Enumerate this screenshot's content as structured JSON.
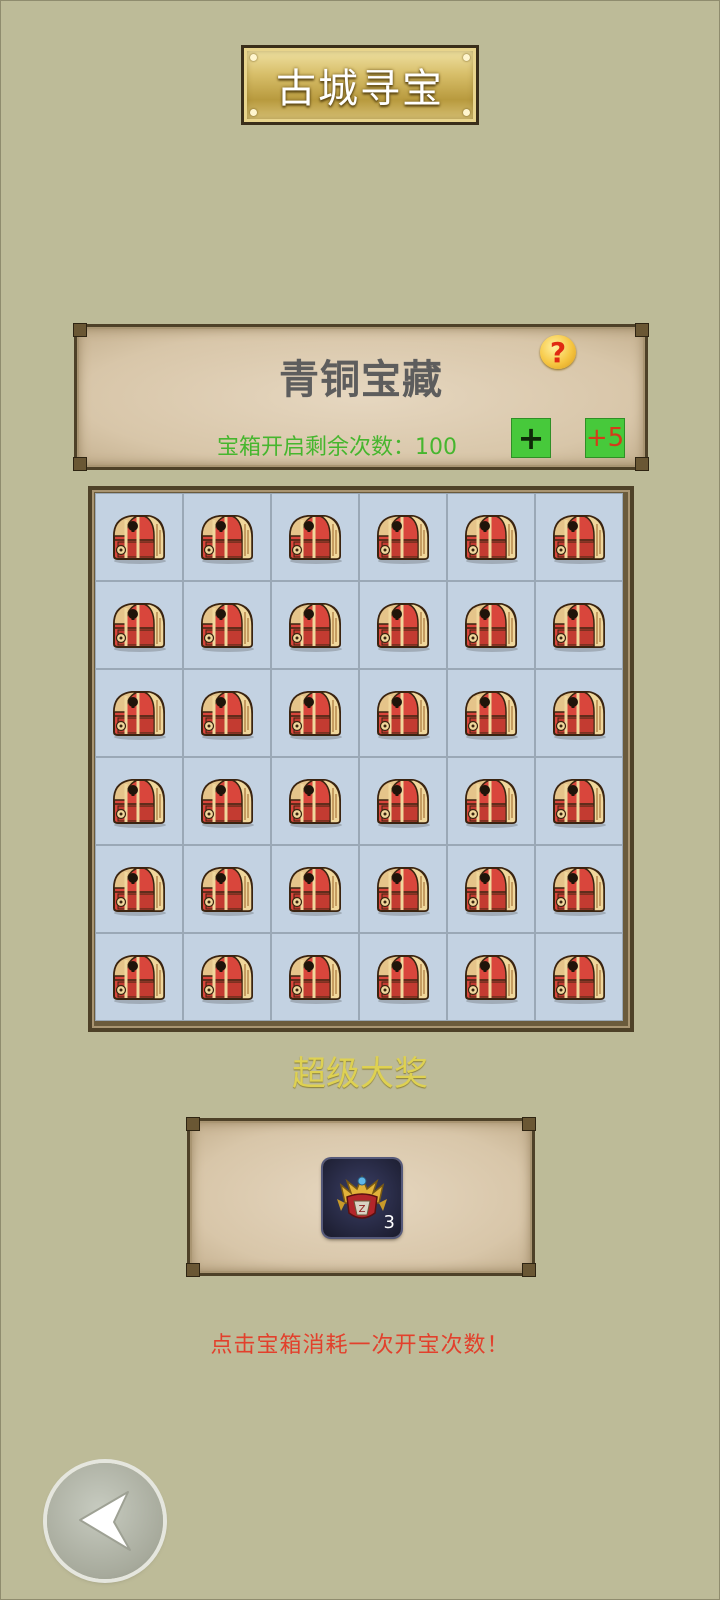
{
  "title": "古城寻宝",
  "info": {
    "treasure_name": "青铜宝藏",
    "help_icon": "question-mark-icon",
    "remaining_label": "宝箱开启剩余次数：",
    "remaining_count": "100",
    "add_one_label": "+",
    "add_five_label": "+5"
  },
  "grid": {
    "rows": 6,
    "cols": 6,
    "cell_icon": "treasure-chest-icon"
  },
  "super_prize": {
    "label": "超级大奖",
    "reward_icon": "crest-badge-icon",
    "reward_count": "3"
  },
  "hint": "点击宝箱消耗一次开宝次数！",
  "back_icon": "arrow-left-icon",
  "colors": {
    "background": "#bdbb98",
    "remaining_text": "#46b62e",
    "button_green": "#47c93b",
    "super_prize_text": "#ded152",
    "hint_text": "#e2402c",
    "cell_bg": "#c3d2e2"
  }
}
